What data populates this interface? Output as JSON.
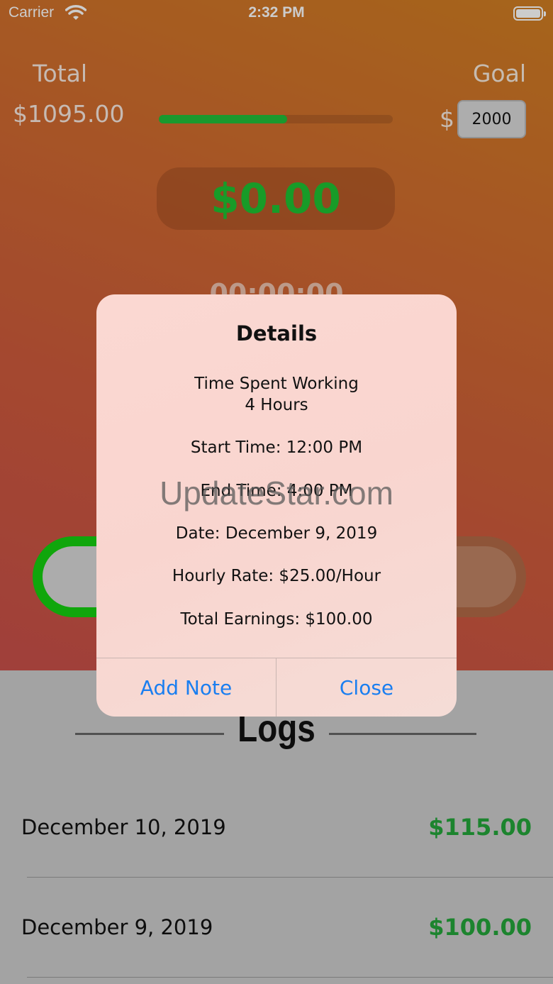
{
  "status_bar": {
    "carrier": "Carrier",
    "time": "2:32 PM"
  },
  "summary": {
    "total_label": "Total",
    "total_value": "$1095.00",
    "goal_label": "Goal",
    "goal_currency": "$",
    "goal_value": "2000",
    "progress_fraction": 0.5475,
    "progress_color": "#20c03a"
  },
  "current_amount": "$0.00",
  "timer": "00:00:00",
  "logs": {
    "title": "Logs",
    "items": [
      {
        "date": "December 10, 2019",
        "amount": "$115.00"
      },
      {
        "date": "December 9, 2019",
        "amount": "$100.00"
      }
    ]
  },
  "dialog": {
    "title": "Details",
    "time_spent_label": "Time Spent Working",
    "time_spent_value": "4 Hours",
    "start_time": "Start Time: 12:00 PM",
    "end_time": "End Time: 4:00 PM",
    "date": "Date: December 9, 2019",
    "hourly_rate": "Hourly Rate: $25.00/Hour",
    "total_earnings": "Total Earnings: $100.00",
    "add_note_label": "Add Note",
    "close_label": "Close"
  },
  "watermark": "UpdateStar.com"
}
